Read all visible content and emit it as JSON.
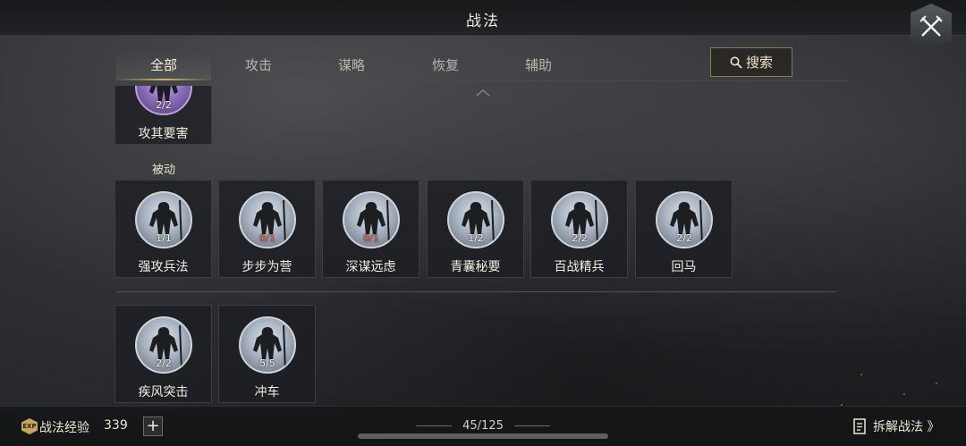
{
  "header": {
    "title": "战法"
  },
  "tabs": [
    {
      "label": "全部",
      "active": true
    },
    {
      "label": "攻击",
      "active": false
    },
    {
      "label": "谋略",
      "active": false
    },
    {
      "label": "恢复",
      "active": false
    },
    {
      "label": "辅助",
      "active": false
    }
  ],
  "search": {
    "label": "搜索",
    "icon": "search-icon"
  },
  "list": {
    "partial_card": {
      "name": "攻其要害",
      "count": "2/2",
      "portrait": "purple"
    },
    "passive_section": {
      "label": "被动"
    },
    "passive_cards": [
      {
        "name": "强攻兵法",
        "count": "1/1",
        "count_red": false
      },
      {
        "name": "步步为营",
        "count": "0/1",
        "count_red": true
      },
      {
        "name": "深谋远虑",
        "count": "0/1",
        "count_red": true
      },
      {
        "name": "青囊秘要",
        "count": "1/2",
        "count_red": false
      },
      {
        "name": "百战精兵",
        "count": "2/2",
        "count_red": false
      },
      {
        "name": "回马",
        "count": "2/2",
        "count_red": false
      }
    ],
    "bottom_cards": [
      {
        "name": "疾风突击",
        "count": "2/2",
        "count_red": false
      },
      {
        "name": "冲车",
        "count": "5/5",
        "count_red": false
      }
    ]
  },
  "footer": {
    "exp_label": "战法经验",
    "exp_value": "339",
    "plus_label": "+",
    "page_counter": "45/125",
    "dismantle_label": "拆解战法 》"
  },
  "colors": {
    "accent_gold": "#d4b26c",
    "count_red": "#e0553d"
  }
}
